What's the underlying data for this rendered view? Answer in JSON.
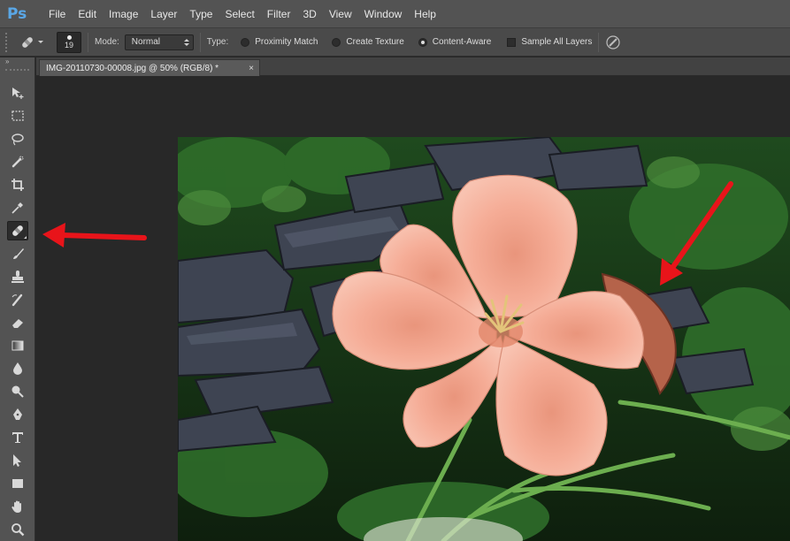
{
  "app": {
    "logo": "Ps",
    "menu": [
      "File",
      "Edit",
      "Image",
      "Layer",
      "Type",
      "Select",
      "Filter",
      "3D",
      "View",
      "Window",
      "Help"
    ]
  },
  "options": {
    "brush_size": "19",
    "mode_label": "Mode:",
    "mode_value": "Normal",
    "type_label": "Type:",
    "type_options": [
      {
        "label": "Proximity Match",
        "selected": false
      },
      {
        "label": "Create Texture",
        "selected": false
      },
      {
        "label": "Content-Aware",
        "selected": true
      }
    ],
    "sample_all_layers": "Sample All Layers"
  },
  "toolpanel": {
    "collapse_glyph": "»",
    "tools": [
      {
        "name": "move-tool",
        "icon": "move-icon"
      },
      {
        "name": "marquee-tool",
        "icon": "rect-marquee-icon"
      },
      {
        "name": "lasso-tool",
        "icon": "lasso-icon"
      },
      {
        "name": "quick-selection-tool",
        "icon": "quick-select-icon"
      },
      {
        "name": "crop-tool",
        "icon": "crop-icon"
      },
      {
        "name": "eyedropper-tool",
        "icon": "eyedropper-icon"
      },
      {
        "name": "spot-healing-brush-tool",
        "icon": "spot-healing-icon",
        "active": true
      },
      {
        "name": "brush-tool",
        "icon": "brush-icon"
      },
      {
        "name": "clone-stamp-tool",
        "icon": "stamp-icon"
      },
      {
        "name": "history-brush-tool",
        "icon": "history-brush-icon"
      },
      {
        "name": "eraser-tool",
        "icon": "eraser-icon"
      },
      {
        "name": "gradient-tool",
        "icon": "gradient-icon"
      },
      {
        "name": "blur-tool",
        "icon": "blur-drop-icon"
      },
      {
        "name": "dodge-tool",
        "icon": "dodge-icon"
      },
      {
        "name": "pen-tool",
        "icon": "pen-icon"
      },
      {
        "name": "type-tool",
        "icon": "type-icon"
      },
      {
        "name": "path-selection-tool",
        "icon": "path-select-icon"
      },
      {
        "name": "shape-tool",
        "icon": "rectangle-icon"
      },
      {
        "name": "hand-tool",
        "icon": "hand-icon"
      },
      {
        "name": "zoom-tool",
        "icon": "zoom-icon"
      }
    ]
  },
  "document": {
    "tab_title": "IMG-20110730-00008.jpg @ 50% (RGB/8) *",
    "close_glyph": "×"
  },
  "colors": {
    "accent_logo": "#5aa7e6",
    "annotation_arrow": "#e8141a",
    "flower": "#f4a892"
  }
}
